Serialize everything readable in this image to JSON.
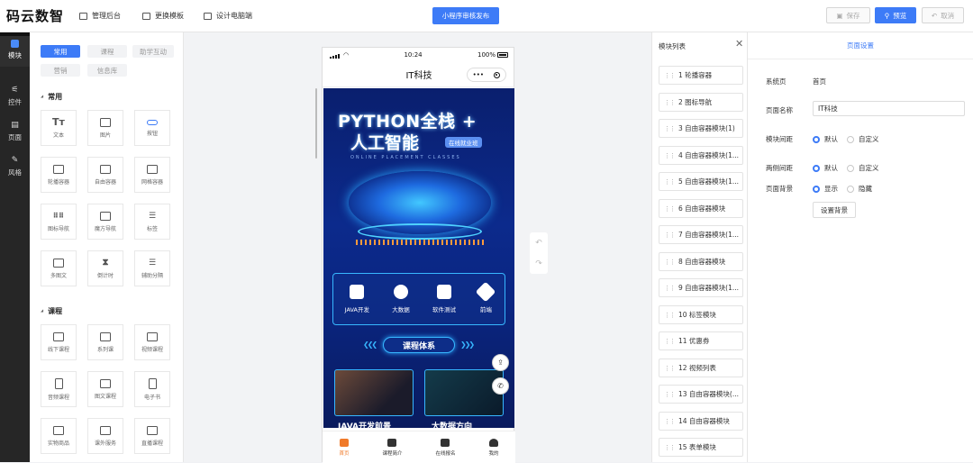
{
  "header": {
    "logo": "码云数智",
    "nav": [
      "管理后台",
      "更换模板",
      "设计电脑端"
    ],
    "publish": "小程序审核发布",
    "save": "保存",
    "preview": "预览",
    "cancel": "取消"
  },
  "rail": [
    "模块",
    "控件",
    "页面",
    "风格"
  ],
  "components": {
    "tabs": [
      "常用",
      "课程",
      "助学互动",
      "营销",
      "信息库"
    ],
    "common_title": "常用",
    "common": [
      "文本",
      "图片",
      "按钮",
      "轮播容器",
      "自由容器",
      "网格容器",
      "图标导航",
      "魔方导航",
      "标签",
      "多图文",
      "倒计时",
      "辅助分隔"
    ],
    "course_title": "课程",
    "course": [
      "线下课程",
      "系列课",
      "视频课程",
      "音频课程",
      "图文课程",
      "电子书",
      "实物商品",
      "课外服务",
      "直播课程"
    ]
  },
  "phone": {
    "time": "10:24",
    "battery": "100%",
    "title": "IT科技",
    "capsule_dots": "•••",
    "banner_title1": "PYTHON全栈 +",
    "banner_title2": "人工智能",
    "banner_tag": "在线就业班",
    "banner_sub": "ONLINE PLACEMENT CLASSES",
    "icons": [
      "JAVA开发",
      "大数据",
      "软件测试",
      "前端"
    ],
    "course_bar": "课程体系",
    "card_labels": [
      "JAVA开发前景",
      "大数据方向"
    ],
    "tabs": [
      "首页",
      "课程简介",
      "在线报名",
      "我的"
    ]
  },
  "modules": {
    "title": "模块列表",
    "items": [
      "1 轮播容器",
      "2 图标导航",
      "3 自由容器模块(1)",
      "4 自由容器模块(1...",
      "5 自由容器模块(1...",
      "6 自由容器模块",
      "7 自由容器模块(1...",
      "8 自由容器模块",
      "9 自由容器模块(1...",
      "10 标签模块",
      "11 优惠券",
      "12 视频列表",
      "13 自由容器模块(...",
      "14 自由容器模块",
      "15 表单模块"
    ]
  },
  "props": {
    "tab": "页面设置",
    "system_label": "系统页",
    "system_value": "首页",
    "name_label": "页面名称",
    "name_value": "IT科技",
    "module_gap_label": "模块间距",
    "side_gap_label": "两侧间距",
    "bg_label": "页面背景",
    "opt_default": "默认",
    "opt_custom": "自定义",
    "opt_show": "显示",
    "opt_hide": "隐藏",
    "bg_button": "设置背景"
  },
  "colors": {
    "accent": "#3d7bf7",
    "tab_active": "#f07a2a",
    "rail": "#262626"
  }
}
